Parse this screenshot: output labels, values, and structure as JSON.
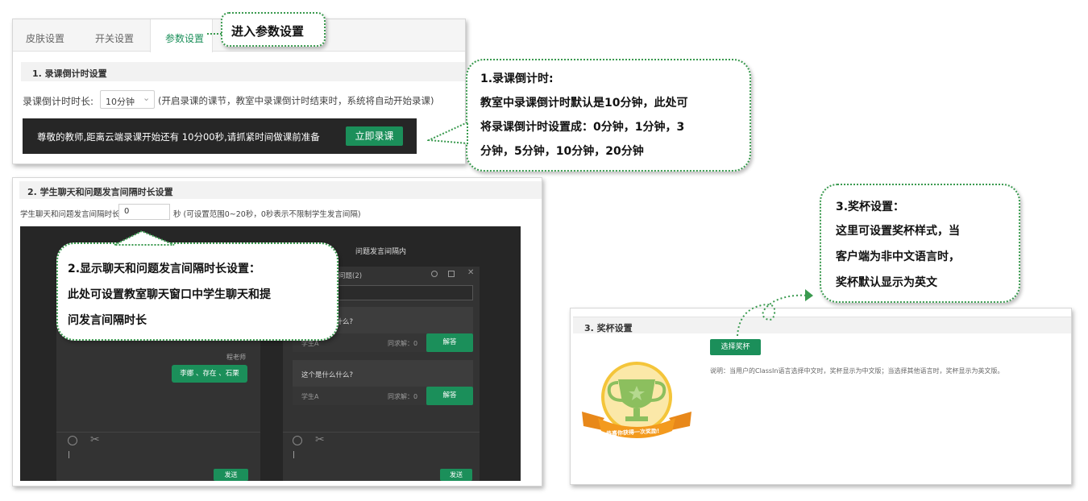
{
  "tabs": [
    {
      "label": "皮肤设置"
    },
    {
      "label": "开关设置"
    },
    {
      "label": "参数设置"
    }
  ],
  "callout_tab": "进入参数设置",
  "section1": {
    "title": "1. 录课倒计时设置",
    "label": "录课倒计时时长:",
    "select_value": "10分钟",
    "hint": "(开启录课的课节，教室中录课倒计时结束时，系统将自动开始录课)",
    "banner_text": "尊敬的教师,距离云端录课开始还有 10分00秒,请抓紧时间做课前准备",
    "banner_button": "立即录课"
  },
  "callout1": {
    "lines": [
      "1.录课倒计时:",
      "教室中录课倒计时默认是10分钟，此处可",
      "将录课倒计时设置成：0分钟，1分钟，3",
      "分钟，5分钟，10分钟，20分钟"
    ]
  },
  "section2": {
    "title": "2. 学生聊天和问题发言间隔时长设置",
    "label": "学生聊天和问题发言间隔时长",
    "input_value": "0",
    "hint": "秒 (可设置范围0~20秒，0秒表示不限制学生发言间隔)",
    "right_title": "问题发言间隔内",
    "left": {
      "teacher": "程老师",
      "bubble": "李娜 、存在 、石栗",
      "send": "发送"
    },
    "right": {
      "header": "问题(2)",
      "q1_text": "这个是什么什么?",
      "q1_student": "学生A",
      "q1_count": "同求解：0",
      "q1_btn": "解答",
      "q2_text": "这个是什么什么?",
      "q2_student": "学生A",
      "q2_count": "同求解：0",
      "q2_btn": "解答",
      "send": "发送"
    }
  },
  "callout2": {
    "lines": [
      "2.显示聊天和问题发言间隔时长设置：",
      "此处可设置教室聊天窗口中学生聊天和提",
      "问发言间隔时长"
    ]
  },
  "section3": {
    "title": "3. 奖杯设置",
    "button": "选择奖杯",
    "hint": "说明：当用户的ClassIn语言选择中文时，奖杯显示为中文版；当选择其他语言时，奖杯显示为英文版。",
    "ribbon_text": "恭喜你获得一次奖励!"
  },
  "callout3": {
    "lines": [
      "3.奖杯设置：",
      "这里可设置奖杯样式，当",
      "客户端为非中文语言时，",
      "奖杯默认显示为英文"
    ]
  },
  "colors": {
    "accent": "#1b8f5a",
    "callout_border": "#3a9a4f",
    "dark_bg": "#262626",
    "panel_bg": "#333333"
  }
}
